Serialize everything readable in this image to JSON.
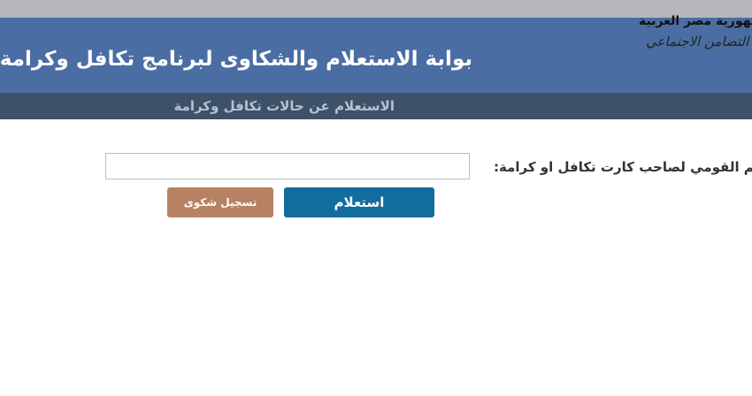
{
  "header": {
    "title": "بوابة الاستعلام والشكاوى لبرنامج تكافل وكرامة",
    "logo_line1": "جمهورية مصر العربية",
    "logo_line2": "وزارة التضامن الاجتماعي"
  },
  "subnav": {
    "link_label": "الاستعلام عن حالات تكافل وكرامة"
  },
  "form": {
    "id_label": "الرقم القومي لصاحب كارت تكافل او كرامة:",
    "id_value": "",
    "inquiry_button": "استعلام",
    "complaint_button": "تسجيل شكوى"
  },
  "colors": {
    "top_strip": "#b6b7bb",
    "header_bg": "#4a6ea3",
    "subnav_bg": "#3d5168",
    "inquiry_button": "#126d9d",
    "complaint_button": "#b68263"
  }
}
